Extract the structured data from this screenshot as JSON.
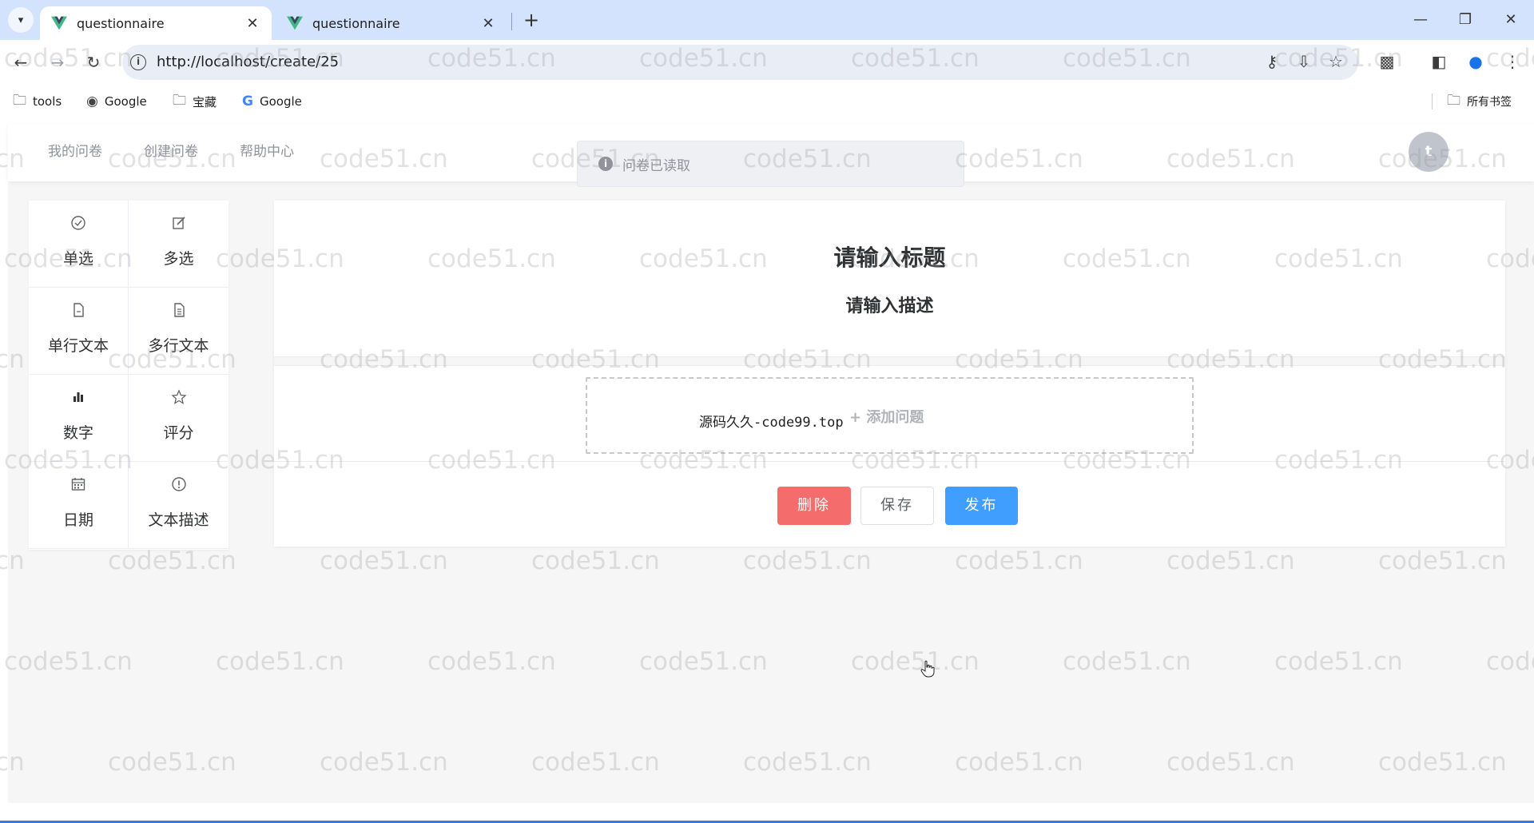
{
  "browser": {
    "tabs": [
      {
        "title": "questionnaire",
        "active": true
      },
      {
        "title": "questionnaire",
        "active": false
      }
    ],
    "url": "http://localhost/create/25",
    "bookmarks": [
      {
        "label": "tools",
        "icon": "folder-icon"
      },
      {
        "label": "Google",
        "icon": "globe-icon"
      },
      {
        "label": "宝藏",
        "icon": "folder-icon"
      },
      {
        "label": "Google",
        "icon": "google-icon"
      }
    ],
    "all_bookmarks": "所有书签"
  },
  "app": {
    "nav": [
      "我的问卷",
      "创建问卷",
      "帮助中心"
    ],
    "avatar_letter": "t",
    "toast": "问卷已读取"
  },
  "palette": [
    {
      "label": "单选",
      "icon": "check-circle-icon"
    },
    {
      "label": "多选",
      "icon": "edit-icon"
    },
    {
      "label": "单行文本",
      "icon": "document-icon"
    },
    {
      "label": "多行文本",
      "icon": "document-lines-icon"
    },
    {
      "label": "数字",
      "icon": "bar-chart-icon"
    },
    {
      "label": "评分",
      "icon": "star-icon"
    },
    {
      "label": "日期",
      "icon": "calendar-icon"
    },
    {
      "label": "文本描述",
      "icon": "info-circle-icon"
    }
  ],
  "editor": {
    "title": "请输入标题",
    "description": "请输入描述",
    "source_text": "源码久久-code99.top",
    "add_question": "+ 添加问题",
    "buttons": {
      "delete": "删除",
      "save": "保存",
      "publish": "发布"
    }
  },
  "watermark": "code51.cn",
  "colors": {
    "danger": "#f56c6c",
    "primary": "#409eff",
    "tabbar": "#d3e3fd"
  }
}
